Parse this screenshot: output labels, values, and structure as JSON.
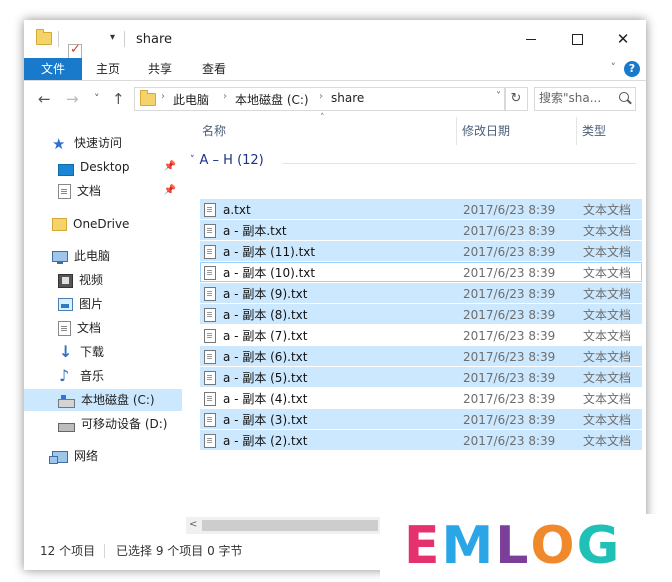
{
  "window": {
    "title": "share",
    "controls": {
      "minimize": "—",
      "maximize": "□",
      "close": "✕"
    },
    "quick_access_arrow": "▾"
  },
  "ribbon": {
    "tabs": [
      {
        "label": "文件",
        "active": true
      },
      {
        "label": "主页"
      },
      {
        "label": "共享"
      },
      {
        "label": "查看"
      }
    ],
    "expand": "˅",
    "help": "?"
  },
  "address": {
    "back": "←",
    "forward": "→",
    "recent": "˅",
    "up": "↑",
    "segments": [
      "此电脑",
      "本地磁盘 (C:)",
      "share"
    ],
    "refresh": "↻",
    "search_placeholder": "搜索\"sha..."
  },
  "sidebar": {
    "items": [
      {
        "label": "快速访问",
        "icon": "star-icon",
        "level": 0
      },
      {
        "label": "Desktop",
        "icon": "desktop-icon",
        "level": 1,
        "pinned": true
      },
      {
        "label": "文档",
        "icon": "document-icon",
        "level": 1,
        "pinned": true
      },
      {
        "label": "OneDrive",
        "icon": "onedrive-folder-icon",
        "level": 0
      },
      {
        "label": "此电脑",
        "icon": "computer-icon",
        "level": 0
      },
      {
        "label": "视频",
        "icon": "video-icon",
        "level": 1
      },
      {
        "label": "图片",
        "icon": "picture-icon",
        "level": 1
      },
      {
        "label": "文档",
        "icon": "document-icon",
        "level": 1
      },
      {
        "label": "下载",
        "icon": "download-icon",
        "level": 1
      },
      {
        "label": "音乐",
        "icon": "music-icon",
        "level": 1
      },
      {
        "label": "本地磁盘 (C:)",
        "icon": "local-disk-icon",
        "level": 1,
        "selected": true
      },
      {
        "label": "可移动设备 (D:)",
        "icon": "removable-drive-icon",
        "level": 1
      },
      {
        "label": "网络",
        "icon": "network-icon",
        "level": 0
      }
    ],
    "pin_glyph": "📌"
  },
  "columns": {
    "name": "名称",
    "date": "修改日期",
    "type": "类型",
    "sort_glyph": "˄"
  },
  "group": {
    "label": "A – H (12)",
    "chevron": "˅"
  },
  "files": [
    {
      "name": "a.txt",
      "date": "2017/6/23 8:39",
      "type": "文本文档",
      "selected": true
    },
    {
      "name": "a - 副本.txt",
      "date": "2017/6/23 8:39",
      "type": "文本文档",
      "selected": true
    },
    {
      "name": "a - 副本 (11).txt",
      "date": "2017/6/23 8:39",
      "type": "文本文档",
      "selected": true
    },
    {
      "name": "a - 副本 (10).txt",
      "date": "2017/6/23 8:39",
      "type": "文本文档",
      "selected": false,
      "focused": true
    },
    {
      "name": "a - 副本 (9).txt",
      "date": "2017/6/23 8:39",
      "type": "文本文档",
      "selected": true
    },
    {
      "name": "a - 副本 (8).txt",
      "date": "2017/6/23 8:39",
      "type": "文本文档",
      "selected": true
    },
    {
      "name": "a - 副本 (7).txt",
      "date": "2017/6/23 8:39",
      "type": "文本文档",
      "selected": false
    },
    {
      "name": "a - 副本 (6).txt",
      "date": "2017/6/23 8:39",
      "type": "文本文档",
      "selected": true
    },
    {
      "name": "a - 副本 (5).txt",
      "date": "2017/6/23 8:39",
      "type": "文本文档",
      "selected": true
    },
    {
      "name": "a - 副本 (4).txt",
      "date": "2017/6/23 8:39",
      "type": "文本文档",
      "selected": false
    },
    {
      "name": "a - 副本 (3).txt",
      "date": "2017/6/23 8:39",
      "type": "文本文档",
      "selected": true
    },
    {
      "name": "a - 副本 (2).txt",
      "date": "2017/6/23 8:39",
      "type": "文本文档",
      "selected": true
    }
  ],
  "status": {
    "item_count": "12 个项目",
    "selection": "已选择 9 个项目  0 字节"
  },
  "scrollbar": {
    "left_arrow": "<"
  },
  "watermark": {
    "letters": [
      {
        "char": "E",
        "color": "#e6316f"
      },
      {
        "char": "M",
        "color": "#2aa6e6"
      },
      {
        "char": "L",
        "color": "#7b3f99"
      },
      {
        "char": "O",
        "color": "#f0892c"
      },
      {
        "char": "G",
        "color": "#1fc1b6"
      }
    ]
  },
  "colors": {
    "accent": "#1979ca",
    "selection": "#cce8ff",
    "focus_border": "#99d1ff",
    "group_header": "#1e3287"
  }
}
